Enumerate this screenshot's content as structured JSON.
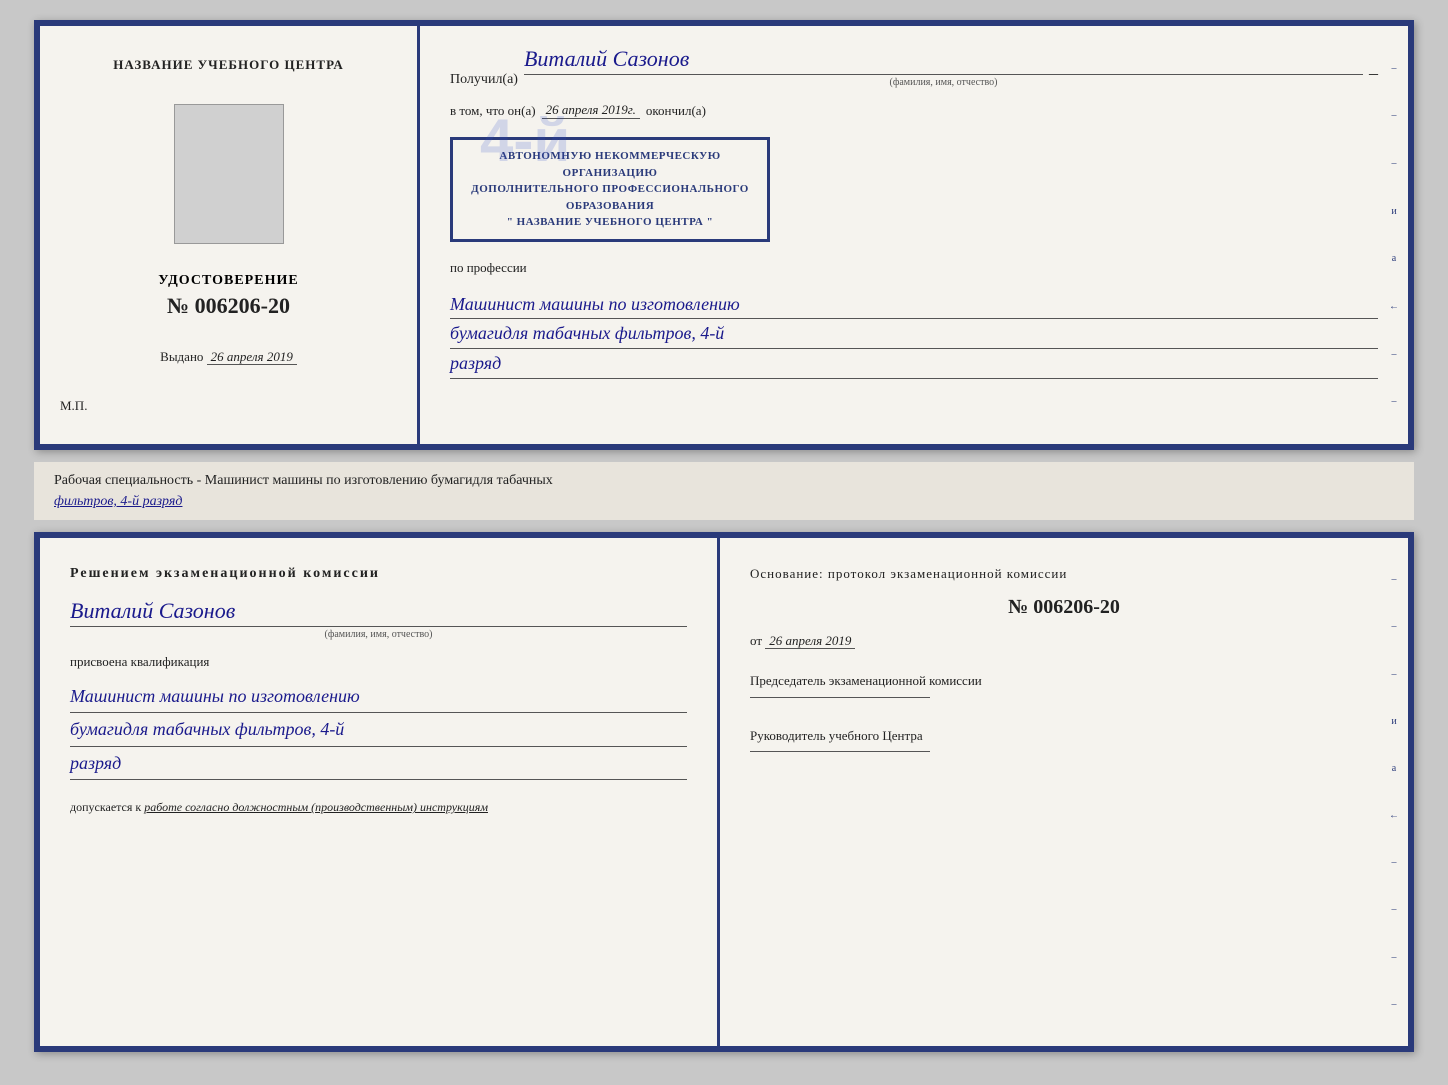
{
  "top_cert": {
    "left": {
      "title": "НАЗВАНИЕ УЧЕБНОГО ЦЕНТРА",
      "udostoverenie_label": "УДОСТОВЕРЕНИЕ",
      "number": "№ 006206-20",
      "vydano_label": "Выдано",
      "vydano_date": "26 апреля 2019",
      "mp": "М.П."
    },
    "right": {
      "poluchil_label": "Получил(а)",
      "name": "Виталий Сазонов",
      "fio_hint": "(фамилия, имя, отчество)",
      "vtom_label": "в том, что он(а)",
      "date": "26 апреля 2019г.",
      "okonchil_label": "окончил(а)",
      "stamp_line1": "АВТОНОМНУЮ НЕКОММЕРЧЕСКУЮ ОРГАНИЗАЦИЮ",
      "stamp_line2": "ДОПОЛНИТЕЛЬНОГО ПРОФЕССИОНАЛЬНОГО ОБРАЗОВАНИЯ",
      "stamp_line3": "\" НАЗВАНИЕ УЧЕБНОГО ЦЕНТРА \"",
      "po_professii_label": "по профессии",
      "profession_line1": "Машинист машины по изготовлению",
      "profession_line2": "бумагидля табачных фильтров, 4-й",
      "profession_line3": "разряд"
    }
  },
  "separator": {
    "text_plain": "Рабочая специальность - Машинист машины по изготовлению бумагидля табачных",
    "text_underlined": "фильтров, 4-й разряд"
  },
  "bottom_cert": {
    "left": {
      "resheniyem_label": "Решением  экзаменационной  комиссии",
      "name": "Виталий Сазонов",
      "fio_hint": "(фамилия, имя, отчество)",
      "prisvoena_label": "присвоена квалификация",
      "prof_line1": "Машинист машины по изготовлению",
      "prof_line2": "бумагидля табачных фильтров, 4-й",
      "prof_line3": "разряд",
      "dopuskaetsya_label": "допускается к",
      "dopuskaetsya_text": "работе согласно должностным (производственным) инструкциям"
    },
    "right": {
      "osnovanie_label": "Основание: протокол экзаменационной  комиссии",
      "number": "№  006206-20",
      "ot_label": "от",
      "date": "26 апреля 2019",
      "predsedatel_label": "Председатель экзаменационной комиссии",
      "rukovoditel_label": "Руководитель учебного Центра"
    }
  },
  "side_marks": {
    "items": [
      "–",
      "–",
      "и",
      "а",
      "←",
      "–",
      "–",
      "–",
      "–",
      "–"
    ]
  }
}
